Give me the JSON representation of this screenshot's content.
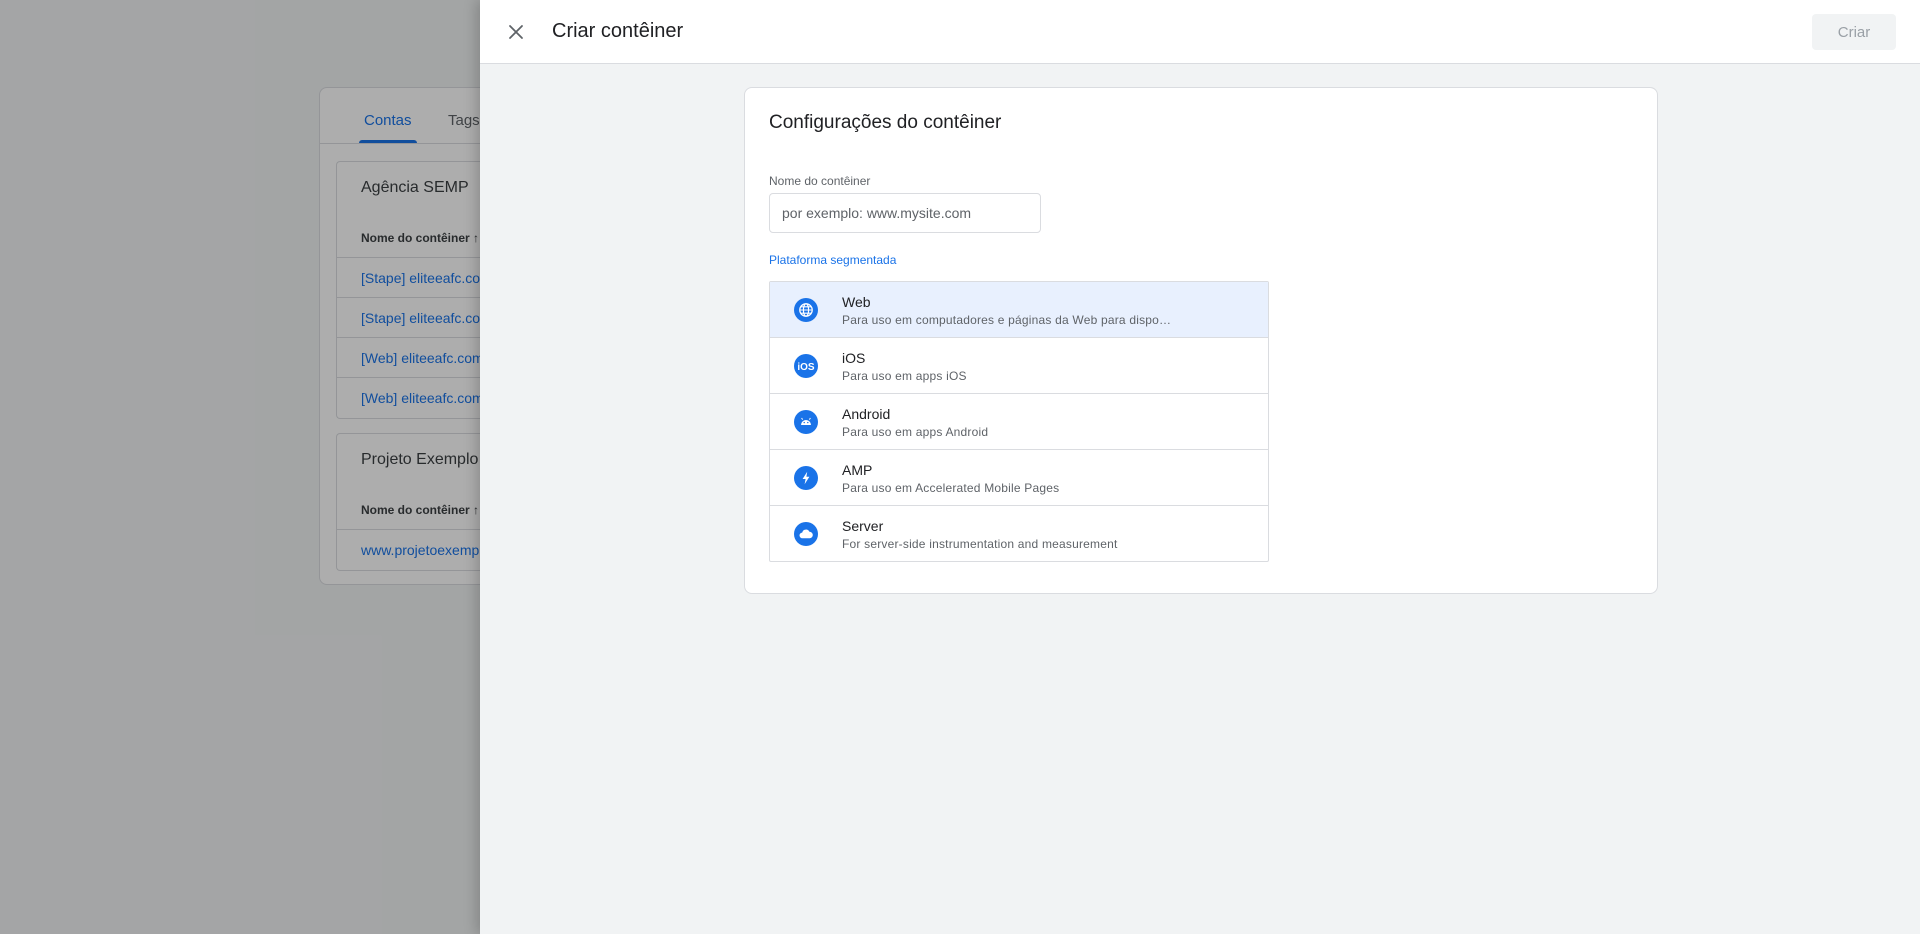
{
  "background": {
    "tabs": [
      {
        "label": "Contas"
      },
      {
        "label": "Tags"
      }
    ],
    "accounts": [
      {
        "name": "Agência SEMP",
        "column_header": "Nome do contêiner ↑",
        "containers": [
          "[Stape] eliteeafc.com",
          "[Stape] eliteeafc.com",
          "[Web] eliteeafc.com",
          "[Web] eliteeafc.com"
        ]
      },
      {
        "name": "Projeto Exemplo",
        "column_header": "Nome do contêiner ↑",
        "containers": [
          "www.projetoexemplo.com"
        ]
      }
    ]
  },
  "drawer": {
    "title": "Criar contêiner",
    "create_label": "Criar",
    "card_title": "Configurações do contêiner",
    "name_label": "Nome do contêiner",
    "name_placeholder": "por exemplo: www.mysite.com",
    "name_value": "",
    "platform_label": "Plataforma segmentada",
    "platforms": [
      {
        "name": "Web",
        "description": "Para uso em computadores e páginas da Web para dispositivos móveis",
        "icon": "globe-icon",
        "selected": true
      },
      {
        "name": "iOS",
        "description": "Para uso em apps iOS",
        "icon": "ios-icon",
        "selected": false
      },
      {
        "name": "Android",
        "description": "Para uso em apps Android",
        "icon": "android-icon",
        "selected": false
      },
      {
        "name": "AMP",
        "description": "Para uso em Accelerated Mobile Pages",
        "icon": "amp-bolt-icon",
        "selected": false
      },
      {
        "name": "Server",
        "description": "For server-side instrumentation and measurement",
        "icon": "cloud-icon",
        "selected": false
      }
    ]
  },
  "colors": {
    "accent": "#1a73e8",
    "selected_bg": "#e8f0fe",
    "surface": "#f1f3f4"
  }
}
